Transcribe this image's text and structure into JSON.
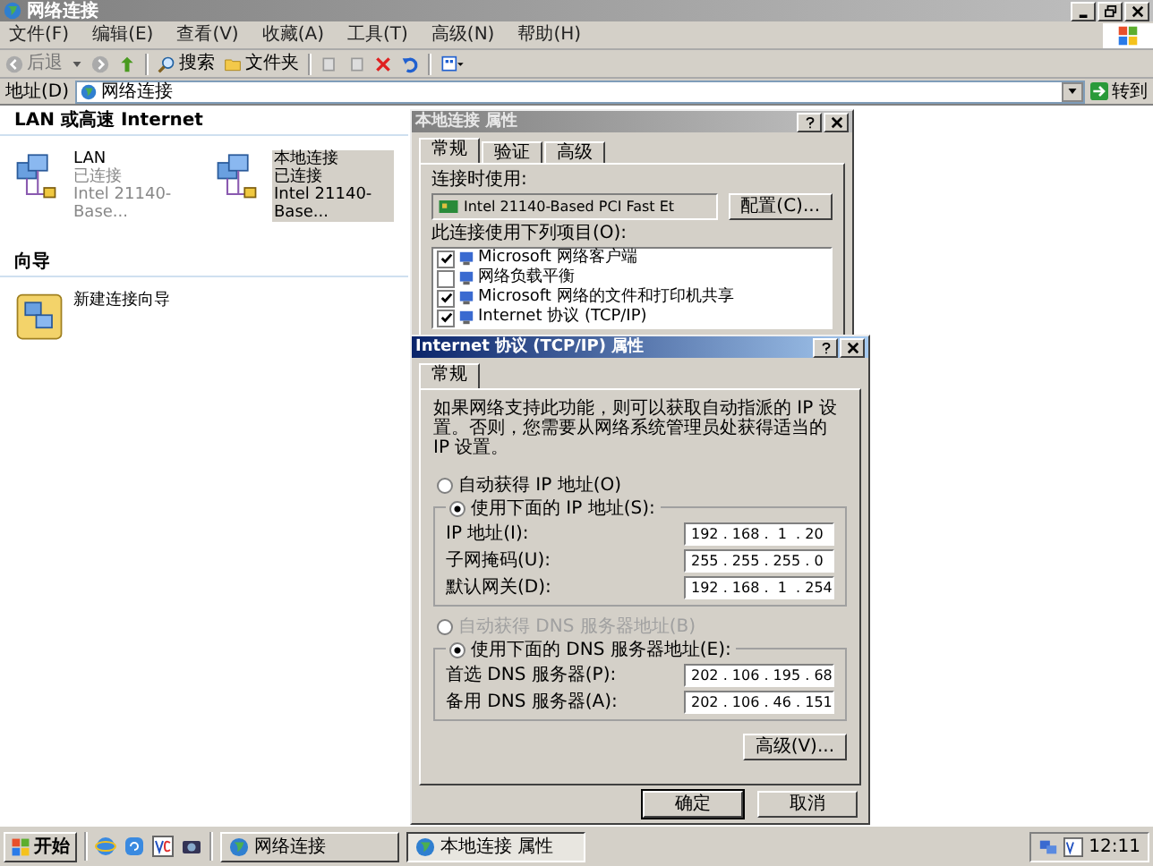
{
  "window": {
    "title": "网络连接"
  },
  "menu": [
    "文件(F)",
    "编辑(E)",
    "查看(V)",
    "收藏(A)",
    "工具(T)",
    "高级(N)",
    "帮助(H)"
  ],
  "toolbar": {
    "back": "后退",
    "search": "搜索",
    "folders": "文件夹"
  },
  "address": {
    "label": "地址(D)",
    "value": "网络连接",
    "go": "转到"
  },
  "sections": [
    {
      "title": "LAN 或高速 Internet",
      "items": [
        {
          "kind": "connection",
          "name": "LAN",
          "status": "已连接",
          "device": "Intel 21140-Base...",
          "selected": false
        },
        {
          "kind": "connection",
          "name": "本地连接",
          "status": "已连接",
          "device": "Intel 21140-Base...",
          "selected": true
        }
      ]
    },
    {
      "title": "向导",
      "items": [
        {
          "kind": "wizard",
          "name": "新建连接向导",
          "selected": false
        }
      ]
    }
  ],
  "properties_dialog": {
    "title": "本地连接 属性",
    "tabs": [
      {
        "label": "常规",
        "selected": true
      },
      {
        "label": "验证",
        "selected": false
      },
      {
        "label": "高级",
        "selected": false
      }
    ],
    "connect_using_label": "连接时使用:",
    "adapter": "Intel 21140-Based PCI Fast Et",
    "configure_button": "配置(C)...",
    "components_label": "此连接使用下列项目(O):",
    "components": [
      {
        "label": "Microsoft 网络客户端",
        "checked": true
      },
      {
        "label": "网络负载平衡",
        "checked": false
      },
      {
        "label": "Microsoft 网络的文件和打印机共享",
        "checked": true
      },
      {
        "label": "Internet 协议 (TCP/IP)",
        "checked": true
      }
    ]
  },
  "tcpip_dialog": {
    "title": "Internet 协议 (TCP/IP) 属性",
    "tabs": [
      {
        "label": "常规",
        "selected": true
      }
    ],
    "description": "如果网络支持此功能，则可以获取自动指派的 IP 设置。否则，您需要从网络系统管理员处获得适当的 IP 设置。",
    "ip_options": [
      {
        "label": "自动获得 IP 地址(O)",
        "selected": false,
        "disabled": false
      },
      {
        "label": "使用下面的 IP 地址(S):",
        "selected": true,
        "disabled": false
      }
    ],
    "ip_fields": [
      {
        "label": "IP 地址(I):",
        "value": "192 . 168 .  1  . 20"
      },
      {
        "label": "子网掩码(U):",
        "value": "255 . 255 . 255 . 0"
      },
      {
        "label": "默认网关(D):",
        "value": "192 . 168 .  1  . 254"
      }
    ],
    "dns_options": [
      {
        "label": "自动获得 DNS 服务器地址(B)",
        "selected": false,
        "disabled": true
      },
      {
        "label": "使用下面的 DNS 服务器地址(E):",
        "selected": true,
        "disabled": false
      }
    ],
    "dns_fields": [
      {
        "label": "首选 DNS 服务器(P):",
        "value": "202 . 106 . 195 . 68"
      },
      {
        "label": "备用 DNS 服务器(A):",
        "value": "202 . 106 . 46 . 151"
      }
    ],
    "advanced_button": "高级(V)...",
    "buttons": [
      "确定",
      "取消"
    ]
  },
  "taskbar": {
    "start": "开始",
    "tasks": [
      {
        "label": "网络连接",
        "selected": false
      },
      {
        "label": "本地连接 属性",
        "selected": true
      }
    ],
    "clock": "12:11"
  }
}
